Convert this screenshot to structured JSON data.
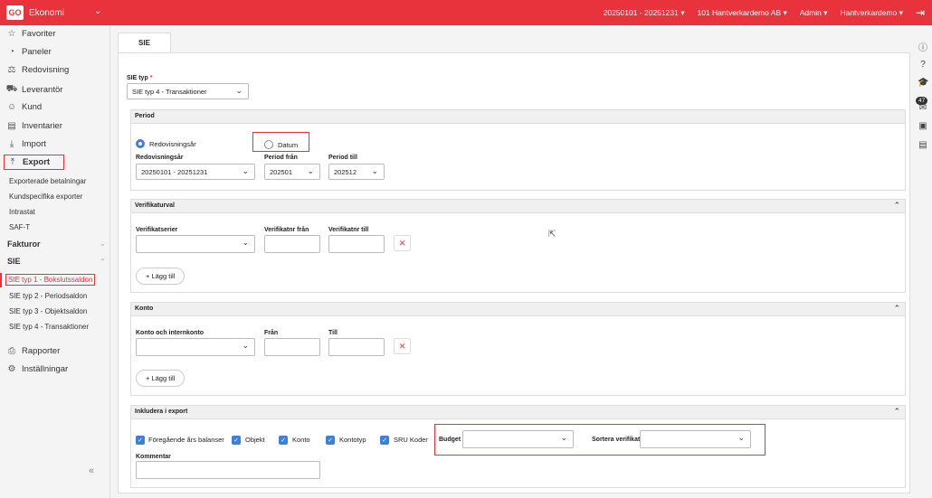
{
  "topbar": {
    "logo": "GO",
    "app": "Ekonomi",
    "period": "20250101 - 20251231",
    "company": "101 Hantverkardemo AB",
    "role": "Admin",
    "user": "Hantverkardemo",
    "accent": "#e8333d"
  },
  "sidebar": {
    "nav": [
      {
        "label": "Favoriter",
        "icon": "star-icon"
      },
      {
        "label": "Paneler",
        "icon": "gauge-icon"
      },
      {
        "label": "Redovisning",
        "icon": "scale-icon"
      },
      {
        "label": "Leverantör",
        "icon": "truck-icon"
      },
      {
        "label": "Kund",
        "icon": "person-icon"
      },
      {
        "label": "Inventarier",
        "icon": "cabinet-icon"
      },
      {
        "label": "Import",
        "icon": "import-icon"
      },
      {
        "label": "Export",
        "icon": "export-icon"
      }
    ],
    "export_items": [
      "Exporterade betalningar",
      "Kundspecifika exporter",
      "Intrastat",
      "SAF-T"
    ],
    "fakturor": "Fakturor",
    "sie": "SIE",
    "sie_items": [
      "SIE typ 1 - Bokslutssaldon",
      "SIE typ 2 - Periodsaldon",
      "SIE typ 3 - Objektsaldon",
      "SIE typ 4 - Transaktioner"
    ],
    "bottom": [
      {
        "label": "Rapporter",
        "icon": "printer-icon"
      },
      {
        "label": "Inställningar",
        "icon": "gear-icon"
      }
    ],
    "collapse": "«"
  },
  "tab": "SIE",
  "sie_type": {
    "label": "SIE typ",
    "required": "*",
    "value": "SIE typ 4 - Transaktioner"
  },
  "period": {
    "title": "Period",
    "radio_fiscal": "Redovisningsår",
    "radio_date": "Datum",
    "fiscal_label": "Redovisningsår",
    "fiscal_value": "20250101 - 20251231",
    "from_label": "Period från",
    "from_value": "202501",
    "to_label": "Period till",
    "to_value": "202512"
  },
  "verifikat": {
    "title": "Verifikaturval",
    "series_label": "Verifikatserier",
    "from_label": "Verifikatnr från",
    "to_label": "Verifikatnr till",
    "add": "+ Lägg till"
  },
  "konto": {
    "title": "Konto",
    "account_label": "Konto och internkonto",
    "from_label": "Från",
    "to_label": "Till",
    "add": "+ Lägg till"
  },
  "include": {
    "title": "Inkludera i export",
    "checks": [
      "Föregående års balanser",
      "Objekt",
      "Konto",
      "Kontotyp",
      "SRU Koder"
    ],
    "budget_label": "Budget",
    "sort_label": "Sortera verifikat",
    "comment_label": "Kommentar"
  },
  "rail": {
    "badge": "47"
  }
}
